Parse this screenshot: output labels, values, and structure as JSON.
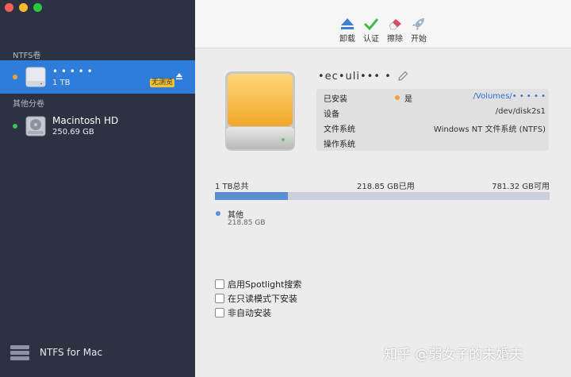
{
  "sidebar": {
    "ntfs_section": "NTFS卷",
    "other_section": "其他分卷",
    "volumes": [
      {
        "name": "• • • • •",
        "size": "1 TB",
        "badge": "无测览",
        "status_color": "#f3a23b",
        "selected": true
      },
      {
        "name": "Macintosh HD",
        "size": "250.69 GB",
        "status_color": "#3ac34d",
        "selected": false
      }
    ],
    "brand": "NTFS for Mac"
  },
  "toolbar": {
    "unmount": "卸载",
    "verify": "认证",
    "erase": "擦除",
    "start": "开始"
  },
  "detail": {
    "disk_name": "•ec•uli••• •",
    "rows": [
      {
        "key": "已安装",
        "status": "是",
        "value": "/Volumes/• • • • •"
      },
      {
        "key": "设备",
        "value": "/dev/disk2s1"
      },
      {
        "key": "文件系统",
        "value": "Windows NT 文件系统 (NTFS)"
      },
      {
        "key": "操作系统",
        "value": ""
      }
    ],
    "total": "1 TB总共",
    "used": "218.85 GB已用",
    "free": "781.32 GB可用",
    "used_fraction": 0.219,
    "legend_name": "其他",
    "legend_size": "218.85 GB"
  },
  "options": [
    {
      "label": "启用Spotlight搜索",
      "checked": false
    },
    {
      "label": "在只读模式下安装",
      "checked": false
    },
    {
      "label": "非自动安装",
      "checked": false
    }
  ],
  "watermark": "知乎 @弱女子的未婚夫"
}
